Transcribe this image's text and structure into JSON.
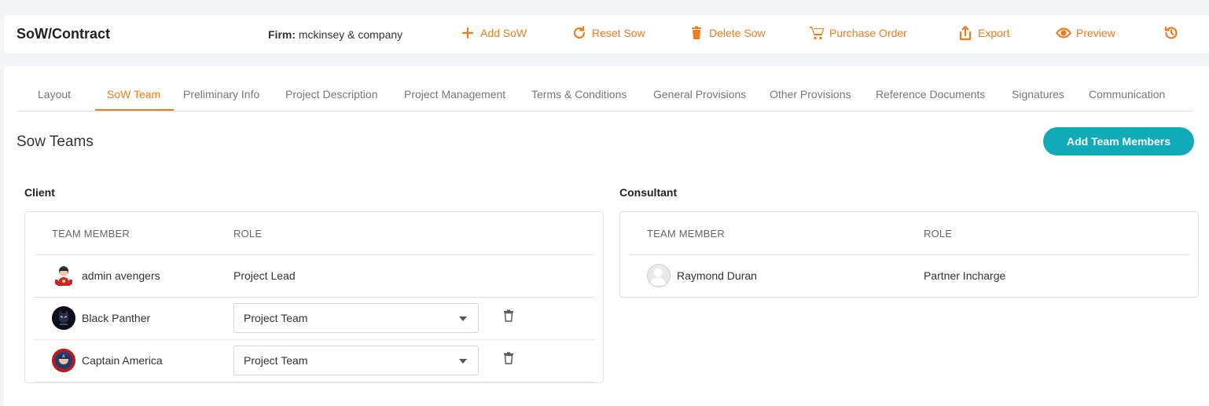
{
  "header": {
    "title": "SoW/Contract",
    "firm_label": "Firm:",
    "firm_value": "mckinsey & company",
    "actions": [
      {
        "label": "Add SoW",
        "icon": "plus-icon"
      },
      {
        "label": "Reset Sow",
        "icon": "refresh-icon"
      },
      {
        "label": "Delete Sow",
        "icon": "trash-icon"
      },
      {
        "label": "Purchase Order",
        "icon": "cart-icon"
      },
      {
        "label": "Export",
        "icon": "export-icon"
      },
      {
        "label": "Preview",
        "icon": "eye-icon"
      },
      {
        "label": "",
        "icon": "history-icon"
      }
    ],
    "accent_color": "#f07c1e"
  },
  "tabs": {
    "items": [
      {
        "label": "Layout"
      },
      {
        "label": "SoW Team"
      },
      {
        "label": "Preliminary Info"
      },
      {
        "label": "Project Description"
      },
      {
        "label": "Project Management"
      },
      {
        "label": "Terms & Conditions"
      },
      {
        "label": "General Provisions"
      },
      {
        "label": "Other Provisions"
      },
      {
        "label": "Reference Documents"
      },
      {
        "label": "Signatures"
      },
      {
        "label": "Communication"
      }
    ],
    "active": "SoW Team"
  },
  "main": {
    "title": "Sow Teams",
    "add_button": "Add Team Members",
    "button_color": "#10aab8"
  },
  "client": {
    "label": "Client",
    "col_member": "TEAM MEMBER",
    "col_role": "ROLE",
    "rows": [
      {
        "name": "admin avengers",
        "role": "Project Lead",
        "avatar": "ironman-avatar-icon",
        "editable": false
      },
      {
        "name": "Black Panther",
        "role": "Project Team",
        "avatar": "black-panther-avatar-icon",
        "editable": true
      },
      {
        "name": "Captain America",
        "role": "Project Team",
        "avatar": "captain-america-avatar-icon",
        "editable": true
      }
    ]
  },
  "consultant": {
    "label": "Consultant",
    "col_member": "TEAM MEMBER",
    "col_role": "ROLE",
    "rows": [
      {
        "name": "Raymond Duran",
        "role": "Partner Incharge",
        "avatar": "default-user-avatar-icon",
        "editable": false
      }
    ]
  }
}
